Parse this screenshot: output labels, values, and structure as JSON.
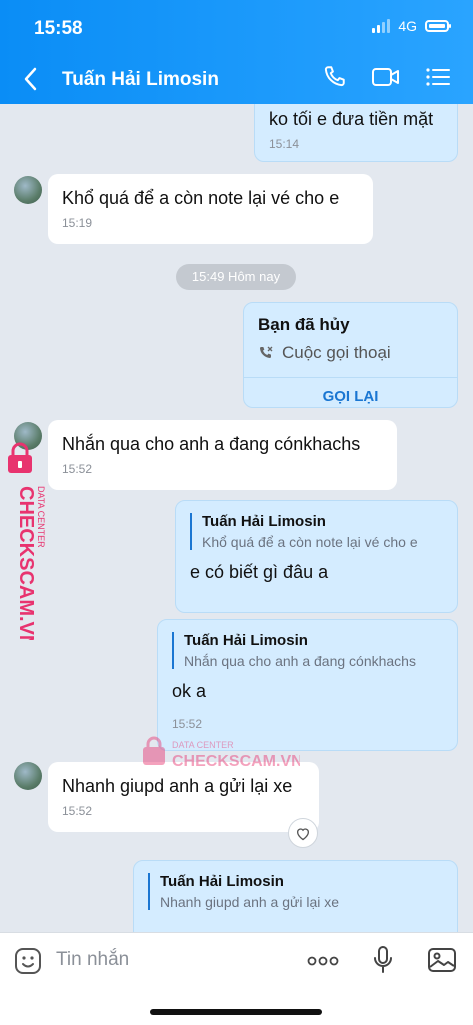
{
  "status": {
    "time": "15:58",
    "network": "4G"
  },
  "header": {
    "title": "Tuấn Hải Limosin"
  },
  "messages": [
    {
      "text": "ko tối e đưa tiền mặt",
      "time": "15:14"
    },
    {
      "text": "Khổ quá để a còn note lại vé cho e",
      "time": "15:19"
    },
    {
      "pill": "15:49 Hôm nay"
    },
    {
      "call_title": "Bạn đã hủy",
      "call_sub": "Cuộc gọi thoại",
      "call_button": "GỌI LẠI"
    },
    {
      "text": "Nhắn qua cho anh a đang cónkhachs",
      "time": "15:52"
    },
    {
      "quote_name": "Tuấn Hải Limosin",
      "quote_text": "Khổ quá để a còn note lại vé cho e",
      "text": "e có biết gì đâu a"
    },
    {
      "quote_name": "Tuấn Hải Limosin",
      "quote_text": "Nhắn qua cho anh a đang cónkhachs",
      "text": "ok a",
      "time": "15:52"
    },
    {
      "text": "Nhanh giupd anh a gửi lại xe",
      "time": "15:52"
    },
    {
      "quote_name": "Tuấn Hải Limosin",
      "quote_text": "Nhanh giupd anh a gửi lại xe"
    }
  ],
  "watermark": {
    "top": "DATA CENTER",
    "brand": "CHECKSCAM.VN"
  },
  "input": {
    "placeholder": "Tin nhắn",
    "more": "ooo"
  },
  "colors": {
    "header": "#0a8df6",
    "outgoing": "#d4ecff",
    "accent": "#1a76d2",
    "watermark": "#e8336f"
  }
}
